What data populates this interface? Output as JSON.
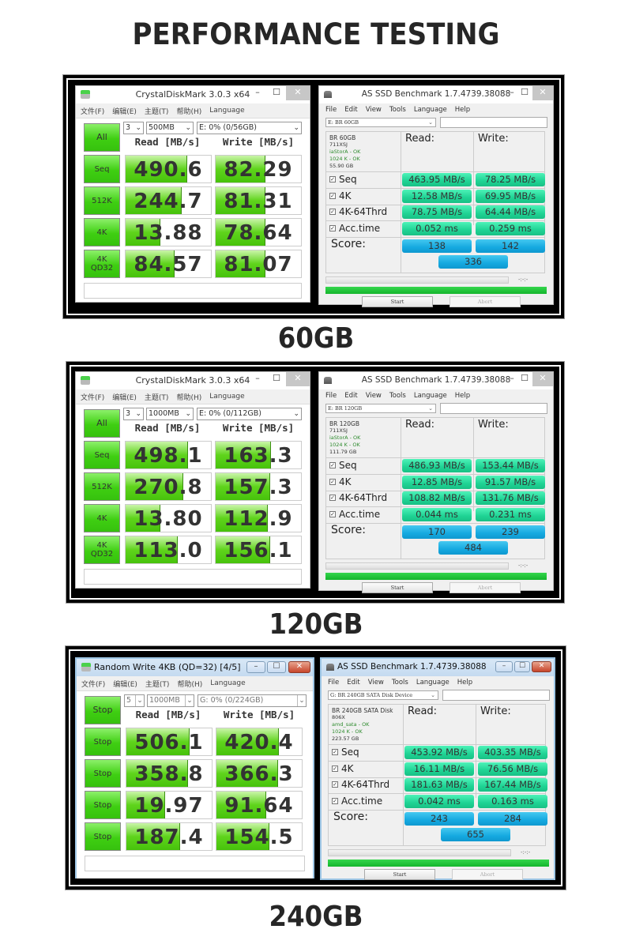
{
  "page": {
    "title": "PERFORMANCE TESTING"
  },
  "sections": [
    {
      "label": "60GB",
      "cdm": {
        "title": "CrystalDiskMark 3.0.3 x64",
        "menu": [
          "文件(F)",
          "编辑(E)",
          "主题(T)",
          "帮助(H)",
          "Language"
        ],
        "run_button": "All",
        "count": "3",
        "size": "500MB",
        "drive": "E: 0% (0/56GB)",
        "read_header": "Read [MB/s]",
        "write_header": "Write [MB/s]",
        "rows": [
          {
            "label": "Seq",
            "read": "490.6",
            "write": "82.29",
            "read_fill": 0.72,
            "write_fill": 0.58
          },
          {
            "label": "512K",
            "read": "244.7",
            "write": "81.31",
            "read_fill": 0.66,
            "write_fill": 0.58
          },
          {
            "label": "4K",
            "read": "13.88",
            "write": "78.64",
            "read_fill": 0.41,
            "write_fill": 0.58
          },
          {
            "label": "4K\nQD32",
            "read": "84.57",
            "write": "81.07",
            "read_fill": 0.57,
            "write_fill": 0.58
          }
        ]
      },
      "asssd": {
        "title": "AS SSD Benchmark 1.7.4739.38088",
        "menu": [
          "File",
          "Edit",
          "View",
          "Tools",
          "Language",
          "Help"
        ],
        "drive_select": "E: BR 60GB",
        "info": {
          "name": "BR 60GB",
          "firmware": "711XSJ",
          "driver": "iaStorA - OK",
          "alignment": "1024 K - OK",
          "capacity": "55.90 GB"
        },
        "read_header": "Read:",
        "write_header": "Write:",
        "rows": [
          {
            "label": "Seq",
            "read": "463.95 MB/s",
            "write": "78.25 MB/s"
          },
          {
            "label": "4K",
            "read": "12.58 MB/s",
            "write": "69.95 MB/s"
          },
          {
            "label": "4K-64Thrd",
            "read": "78.75 MB/s",
            "write": "64.44 MB/s"
          },
          {
            "label": "Acc.time",
            "read": "0.052 ms",
            "write": "0.259 ms"
          }
        ],
        "score_label": "Score:",
        "score_read": "138",
        "score_write": "142",
        "score_total": "336",
        "time": "-:-:-",
        "start_button": "Start",
        "abort_button": "Abort"
      }
    },
    {
      "label": "120GB",
      "cdm": {
        "title": "CrystalDiskMark 3.0.3 x64",
        "menu": [
          "文件(F)",
          "编辑(E)",
          "主题(T)",
          "帮助(H)",
          "Language"
        ],
        "run_button": "All",
        "count": "3",
        "size": "1000MB",
        "drive": "E: 0% (0/112GB)",
        "read_header": "Read [MB/s]",
        "write_header": "Write [MB/s]",
        "rows": [
          {
            "label": "Seq",
            "read": "498.1",
            "write": "163.3",
            "read_fill": 0.73,
            "write_fill": 0.65
          },
          {
            "label": "512K",
            "read": "270.8",
            "write": "157.3",
            "read_fill": 0.68,
            "write_fill": 0.64
          },
          {
            "label": "4K",
            "read": "13.80",
            "write": "112.9",
            "read_fill": 0.41,
            "write_fill": 0.61
          },
          {
            "label": "4K\nQD32",
            "read": "113.0",
            "write": "156.1",
            "read_fill": 0.61,
            "write_fill": 0.64
          }
        ]
      },
      "asssd": {
        "title": "AS SSD Benchmark 1.7.4739.38088",
        "menu": [
          "File",
          "Edit",
          "View",
          "Tools",
          "Language",
          "Help"
        ],
        "drive_select": "E: BR 120GB",
        "info": {
          "name": "BR 120GB",
          "firmware": "711XSJ",
          "driver": "iaStorA - OK",
          "alignment": "1024 K - OK",
          "capacity": "111.79 GB"
        },
        "read_header": "Read:",
        "write_header": "Write:",
        "rows": [
          {
            "label": "Seq",
            "read": "486.93 MB/s",
            "write": "153.44 MB/s"
          },
          {
            "label": "4K",
            "read": "12.85 MB/s",
            "write": "91.57 MB/s"
          },
          {
            "label": "4K-64Thrd",
            "read": "108.82 MB/s",
            "write": "131.76 MB/s"
          },
          {
            "label": "Acc.time",
            "read": "0.044 ms",
            "write": "0.231 ms"
          }
        ],
        "score_label": "Score:",
        "score_read": "170",
        "score_write": "239",
        "score_total": "484",
        "time": "-:-:-",
        "start_button": "Start",
        "abort_button": "Abort"
      }
    },
    {
      "label": "240GB",
      "cdm": {
        "title": "Random Write 4KB (QD=32) [4/5]",
        "menu": [
          "文件(F)",
          "编辑(E)",
          "主题(T)",
          "帮助(H)",
          "Language"
        ],
        "run_button": "Stop",
        "count": "5",
        "size": "1000MB",
        "drive": "G: 0% (0/224GB)",
        "read_header": "Read [MB/s]",
        "write_header": "Write [MB/s]",
        "rows": [
          {
            "label": "Stop",
            "read": "506.1",
            "write": "420.4",
            "read_fill": 0.74,
            "write_fill": 0.73
          },
          {
            "label": "Stop",
            "read": "358.8",
            "write": "366.3",
            "read_fill": 0.72,
            "write_fill": 0.72
          },
          {
            "label": "Stop",
            "read": "19.97",
            "write": "91.64",
            "read_fill": 0.45,
            "write_fill": 0.58
          },
          {
            "label": "Stop",
            "read": "187.4",
            "write": "154.5",
            "read_fill": 0.63,
            "write_fill": 0.62
          }
        ]
      },
      "asssd": {
        "title": "AS SSD Benchmark 1.7.4739.38088",
        "menu": [
          "File",
          "Edit",
          "View",
          "Tools",
          "Language",
          "Help"
        ],
        "drive_select": "G: BR 240GB  SATA Disk Device",
        "info": {
          "name": "BR 240GB  SATA Disk",
          "firmware": "806X",
          "driver": "amd_sata - OK",
          "alignment": "1024 K - OK",
          "capacity": "223.57 GB"
        },
        "read_header": "Read:",
        "write_header": "Write:",
        "rows": [
          {
            "label": "Seq",
            "read": "453.92 MB/s",
            "write": "403.35 MB/s"
          },
          {
            "label": "4K",
            "read": "16.11 MB/s",
            "write": "76.56 MB/s"
          },
          {
            "label": "4K-64Thrd",
            "read": "181.63 MB/s",
            "write": "167.44 MB/s"
          },
          {
            "label": "Acc.time",
            "read": "0.042 ms",
            "write": "0.163 ms"
          }
        ],
        "score_label": "Score:",
        "score_read": "243",
        "score_write": "284",
        "score_total": "655",
        "time": "-:-:-",
        "start_button": "Start",
        "abort_button": "Abort"
      }
    }
  ],
  "icons": {
    "min": "–",
    "max": "☐",
    "close": "✕",
    "dropdown": "⌄",
    "check": "✓"
  }
}
